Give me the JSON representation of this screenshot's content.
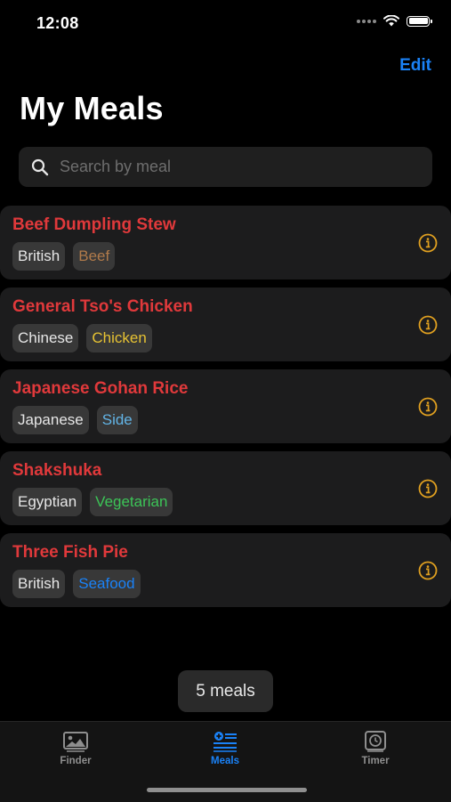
{
  "status_bar": {
    "time": "12:08",
    "battery_level": 1.0
  },
  "header": {
    "edit_label": "Edit",
    "title": "My Meals"
  },
  "search": {
    "placeholder": "Search by meal",
    "value": "",
    "icon": "search-icon"
  },
  "meals": [
    {
      "name": "Beef Dumpling Stew",
      "area": "British",
      "category": "Beef",
      "category_color": "#b07a4a"
    },
    {
      "name": "General Tso's Chicken",
      "area": "Chinese",
      "category": "Chicken",
      "category_color": "#e6c233"
    },
    {
      "name": "Japanese Gohan Rice",
      "area": "Japanese",
      "category": "Side",
      "category_color": "#62b4e6"
    },
    {
      "name": "Shakshuka",
      "area": "Egyptian",
      "category": "Vegetarian",
      "category_color": "#3cc457"
    },
    {
      "name": "Three Fish Pie",
      "area": "British",
      "category": "Seafood",
      "category_color": "#1a82f7"
    }
  ],
  "meal_count_label": "5 meals",
  "tabs": [
    {
      "label": "Finder",
      "icon": "photo-icon",
      "active": false
    },
    {
      "label": "Meals",
      "icon": "list-add-icon",
      "active": true
    },
    {
      "label": "Timer",
      "icon": "timer-icon",
      "active": false
    }
  ],
  "colors": {
    "accent": "#1a82f7",
    "meal_name": "#e0393b",
    "info_icon": "#e0a020"
  }
}
